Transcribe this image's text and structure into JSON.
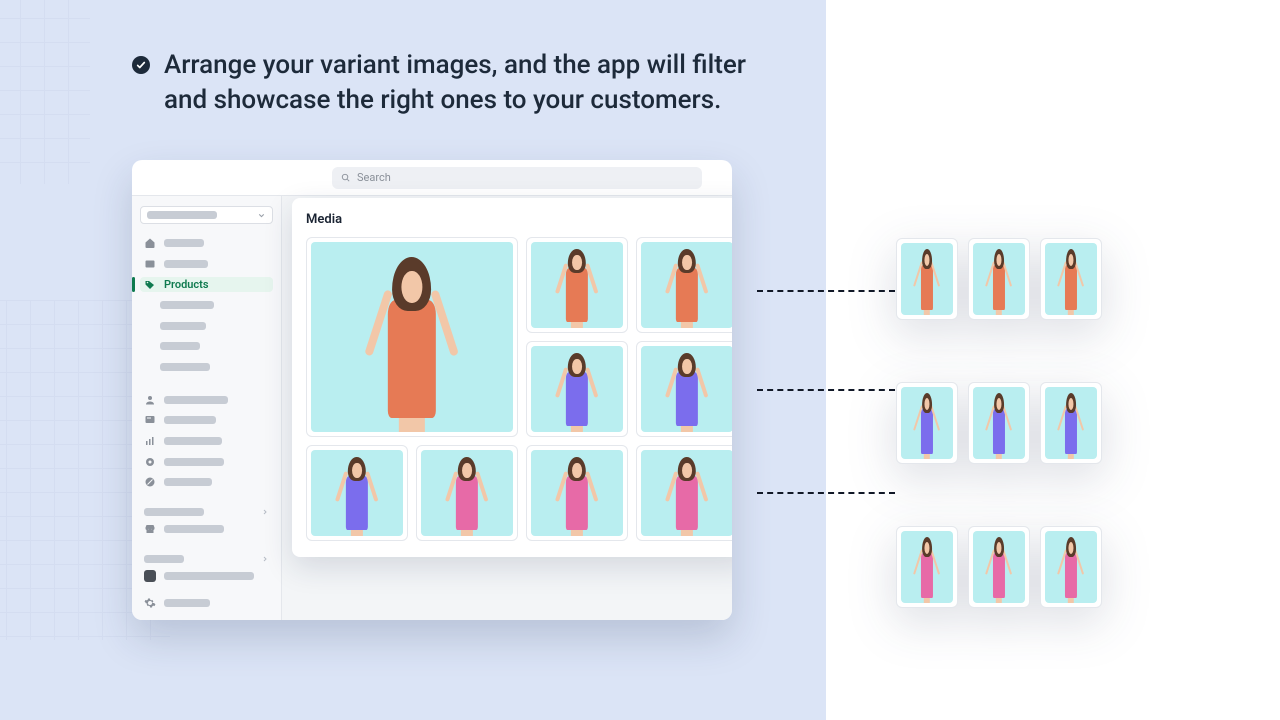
{
  "headline": {
    "text": "Arrange your variant images, and the app will filter and showcase the right ones to your customers."
  },
  "search": {
    "placeholder": "Search"
  },
  "sidebar": {
    "products_label": "Products"
  },
  "media": {
    "title": "Media"
  },
  "media_grid": [
    {
      "variant": "orange",
      "size": "big"
    },
    {
      "variant": "orange"
    },
    {
      "variant": "orange"
    },
    {
      "variant": "purple"
    },
    {
      "variant": "purple"
    },
    {
      "variant": "purple"
    },
    {
      "variant": "pink"
    },
    {
      "variant": "pink"
    },
    {
      "variant": "pink"
    }
  ],
  "variant_groups": [
    {
      "variant": "orange",
      "count": 3
    },
    {
      "variant": "purple",
      "count": 3
    },
    {
      "variant": "pink",
      "count": 3
    }
  ]
}
